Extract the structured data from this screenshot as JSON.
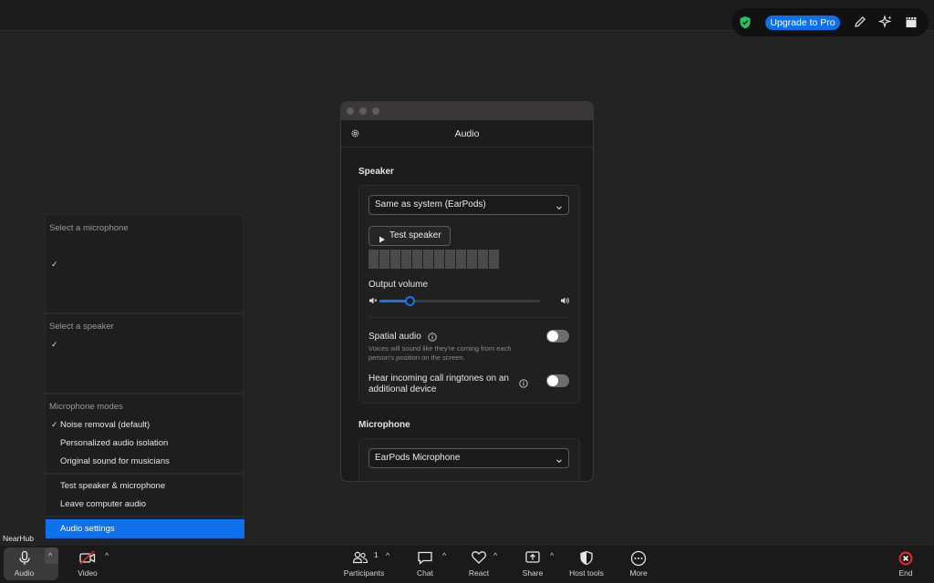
{
  "top_bar": {
    "upgrade_label": "Upgrade to Pro",
    "icons": [
      "shield-check-icon",
      "pencil-icon",
      "sparkle-icon",
      "clapperboard-icon"
    ]
  },
  "dialog": {
    "title": "Audio",
    "speaker_section": "Speaker",
    "speaker_device": "Same as system (EarPods)",
    "test_speaker_label": "Test speaker",
    "output_volume_label": "Output volume",
    "output_volume_level": 0.19,
    "spatial_audio_label": "Spatial audio",
    "spatial_audio_desc_1": "Voices will sound like they're coming from each",
    "spatial_audio_desc_2": "person's position on the screen.",
    "spatial_audio_on": false,
    "ringtone_label_1": "Hear incoming call ringtones on an",
    "ringtone_label_2": "additional device",
    "ringtone_on": false,
    "microphone_section": "Microphone",
    "microphone_device": "EarPods Microphone"
  },
  "menu": {
    "select_microphone": "Select a microphone",
    "select_speaker": "Select a speaker",
    "check": "✓",
    "modes_header": "Microphone modes",
    "modes": [
      "Noise removal (default)",
      "Personalized audio isolation",
      "Original sound for musicians"
    ],
    "test_label": "Test speaker & microphone",
    "leave_label": "Leave computer audio",
    "settings_label": "Audio settings"
  },
  "participant_name": "NearHub",
  "toolbar": {
    "audio": "Audio",
    "video": "Video",
    "participants": "Participants",
    "participants_count": "1",
    "chat": "Chat",
    "react": "React",
    "share": "Share",
    "host_tools": "Host tools",
    "more": "More",
    "end": "End",
    "caret": "^"
  },
  "colors": {
    "accent": "#0e71eb",
    "end": "#e02828"
  }
}
